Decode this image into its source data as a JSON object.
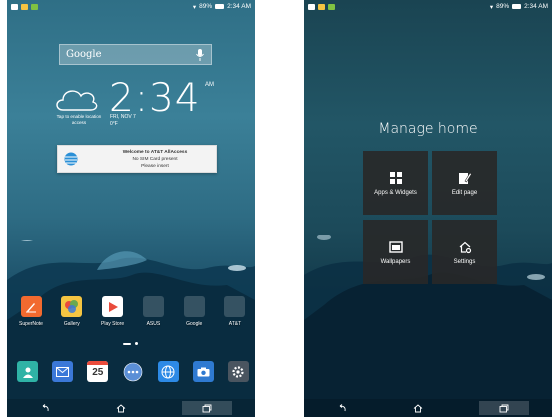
{
  "left_screen": {
    "status": {
      "signal_text": "89%",
      "time": "2:34 AM"
    },
    "search": {
      "placeholder": "Google"
    },
    "clock": {
      "time": "2:34",
      "ampm": "AM",
      "weather_hint": "Tap to enable location access",
      "date_line1": "FRI, NOV 7",
      "date_line2": "0°F"
    },
    "notification": {
      "title": "Welcome to AT&T AllAccess",
      "line2": "No SIM Card present",
      "line3": "Please insert"
    },
    "apps": [
      {
        "label": "SuperNote",
        "icon": "supernote-icon",
        "color": "#f26a2f"
      },
      {
        "label": "Gallery",
        "icon": "gallery-icon",
        "color": "#f5c542"
      },
      {
        "label": "Play Store",
        "icon": "play-store-icon",
        "color": "#ffffff"
      },
      {
        "label": "ASUS",
        "icon": "asus-folder-icon",
        "color": "#4a6fd1"
      },
      {
        "label": "Google",
        "icon": "google-folder-icon",
        "color": "#6aa84f"
      },
      {
        "label": "AT&T",
        "icon": "att-folder-icon",
        "color": "#5aa0d8"
      }
    ],
    "dock": [
      {
        "name": "contacts",
        "icon": "contacts-icon",
        "color": "#2fb3a6"
      },
      {
        "name": "email",
        "icon": "email-icon",
        "color": "#3b78d8"
      },
      {
        "name": "calendar",
        "icon": "calendar-icon",
        "color": "#ffffff",
        "day": "25"
      },
      {
        "name": "all-apps",
        "icon": "all-apps-icon",
        "color": "#5b8fd6"
      },
      {
        "name": "browser",
        "icon": "browser-icon",
        "color": "#2d8ae6"
      },
      {
        "name": "camera",
        "icon": "camera-icon",
        "color": "#2f7ad1"
      },
      {
        "name": "settings",
        "icon": "settings-icon",
        "color": "#4a5560"
      }
    ]
  },
  "right_screen": {
    "status": {
      "signal_text": "89%",
      "time": "2:34 AM"
    },
    "title": "Manage home",
    "tiles": [
      {
        "label": "Apps & Widgets",
        "icon": "apps-widgets-icon"
      },
      {
        "label": "Edit page",
        "icon": "edit-page-icon"
      },
      {
        "label": "Wallpapers",
        "icon": "wallpapers-icon"
      },
      {
        "label": "Settings",
        "icon": "home-settings-icon"
      }
    ]
  }
}
